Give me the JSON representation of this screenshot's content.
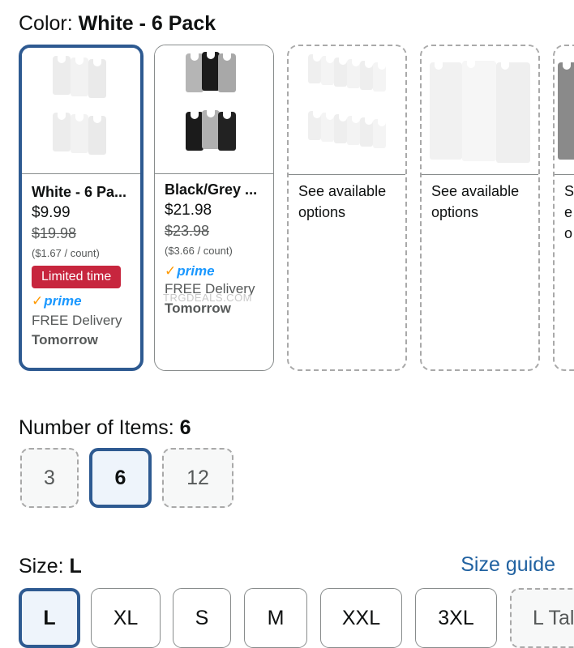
{
  "color": {
    "label": "Color: ",
    "selected": "White - 6 Pack",
    "options": [
      {
        "title": "White - 6 Pa...",
        "price": "$9.99",
        "list_price": "$19.98",
        "unit_price": "($1.67 / count)",
        "badge": "Limited time",
        "prime": "prime",
        "delivery": "FREE Delivery",
        "delivery_day": "Tomorrow"
      },
      {
        "title": "Black/Grey ...",
        "price": "$21.98",
        "list_price": "$23.98",
        "unit_price": "($3.66 / count)",
        "prime": "prime",
        "delivery": "FREE Delivery",
        "delivery_day": "Tomorrow",
        "watermark": "TRGDEALS.COM"
      },
      {
        "availability": "See available options"
      },
      {
        "availability": "See available options"
      },
      {
        "availability": "Se o"
      }
    ]
  },
  "items": {
    "label": "Number of Items: ",
    "selected": "6",
    "options": [
      "3",
      "6",
      "12"
    ]
  },
  "size": {
    "label": "Size: ",
    "selected": "L",
    "guide": "Size guide",
    "options": [
      "L",
      "XL",
      "S",
      "M",
      "XXL",
      "3XL",
      "L Tal"
    ]
  }
}
